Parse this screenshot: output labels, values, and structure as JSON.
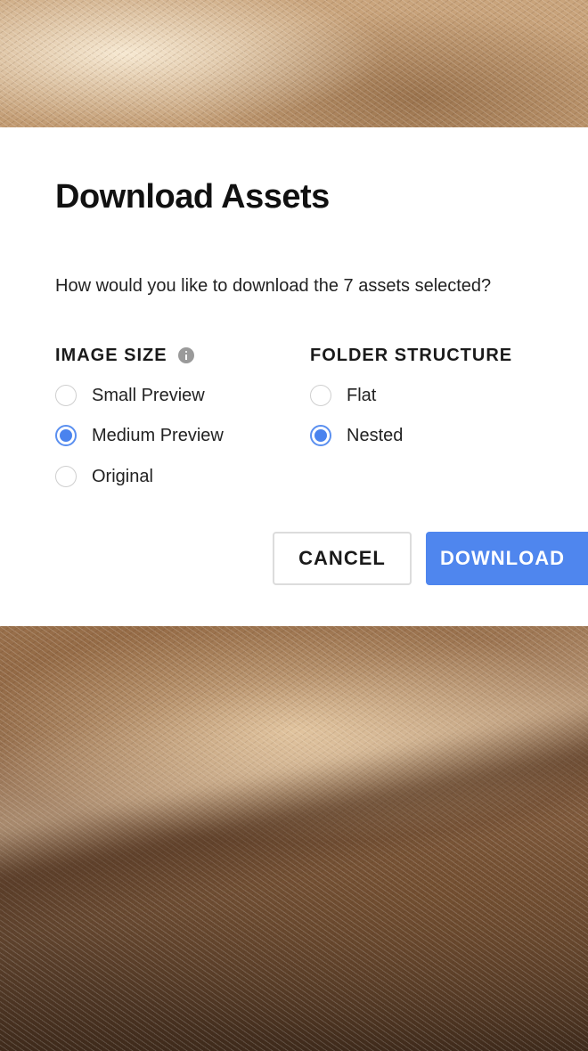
{
  "dialog": {
    "title": "Download Assets",
    "prompt": "How would you like to download the 7 assets selected?"
  },
  "image_size": {
    "label": "IMAGE SIZE",
    "info_icon": "info-icon",
    "options": [
      {
        "label": "Small Preview",
        "checked": false
      },
      {
        "label": "Medium Preview",
        "checked": true
      },
      {
        "label": "Original",
        "checked": false
      }
    ]
  },
  "folder_structure": {
    "label": "FOLDER STRUCTURE",
    "options": [
      {
        "label": "Flat",
        "checked": false
      },
      {
        "label": "Nested",
        "checked": true
      }
    ]
  },
  "actions": {
    "cancel_label": "CANCEL",
    "download_label": "DOWNLOAD"
  },
  "colors": {
    "accent": "#4f86ee",
    "modal_bg": "#ffffff"
  }
}
